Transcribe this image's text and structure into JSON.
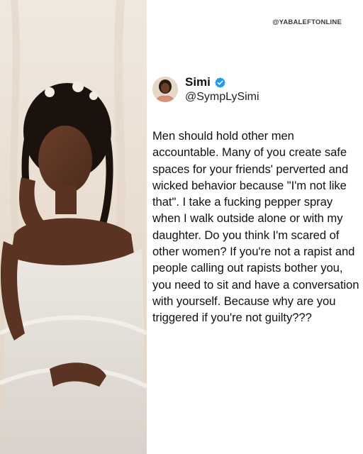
{
  "watermark": {
    "text": "@YABALEFTONLINE"
  },
  "tweet": {
    "display_name": "Simi",
    "handle": "@SympLySimi",
    "verified_icon": "verified-badge-icon",
    "verified_color": "#1d9bf0",
    "text": "Men should hold other men accountable. Many of you create safe spaces for your friends' perverted and wicked behavior because \"I'm not like that\". I take a fucking pepper spray when I walk outside alone or with my daughter. Do you think I'm scared of other women? If you're not a rapist and people calling out rapists bother you, you need to sit and have a conversation with yourself. Because why are you triggered if you're not guilty???"
  },
  "colors": {
    "text": "#111111",
    "background": "#ffffff"
  }
}
